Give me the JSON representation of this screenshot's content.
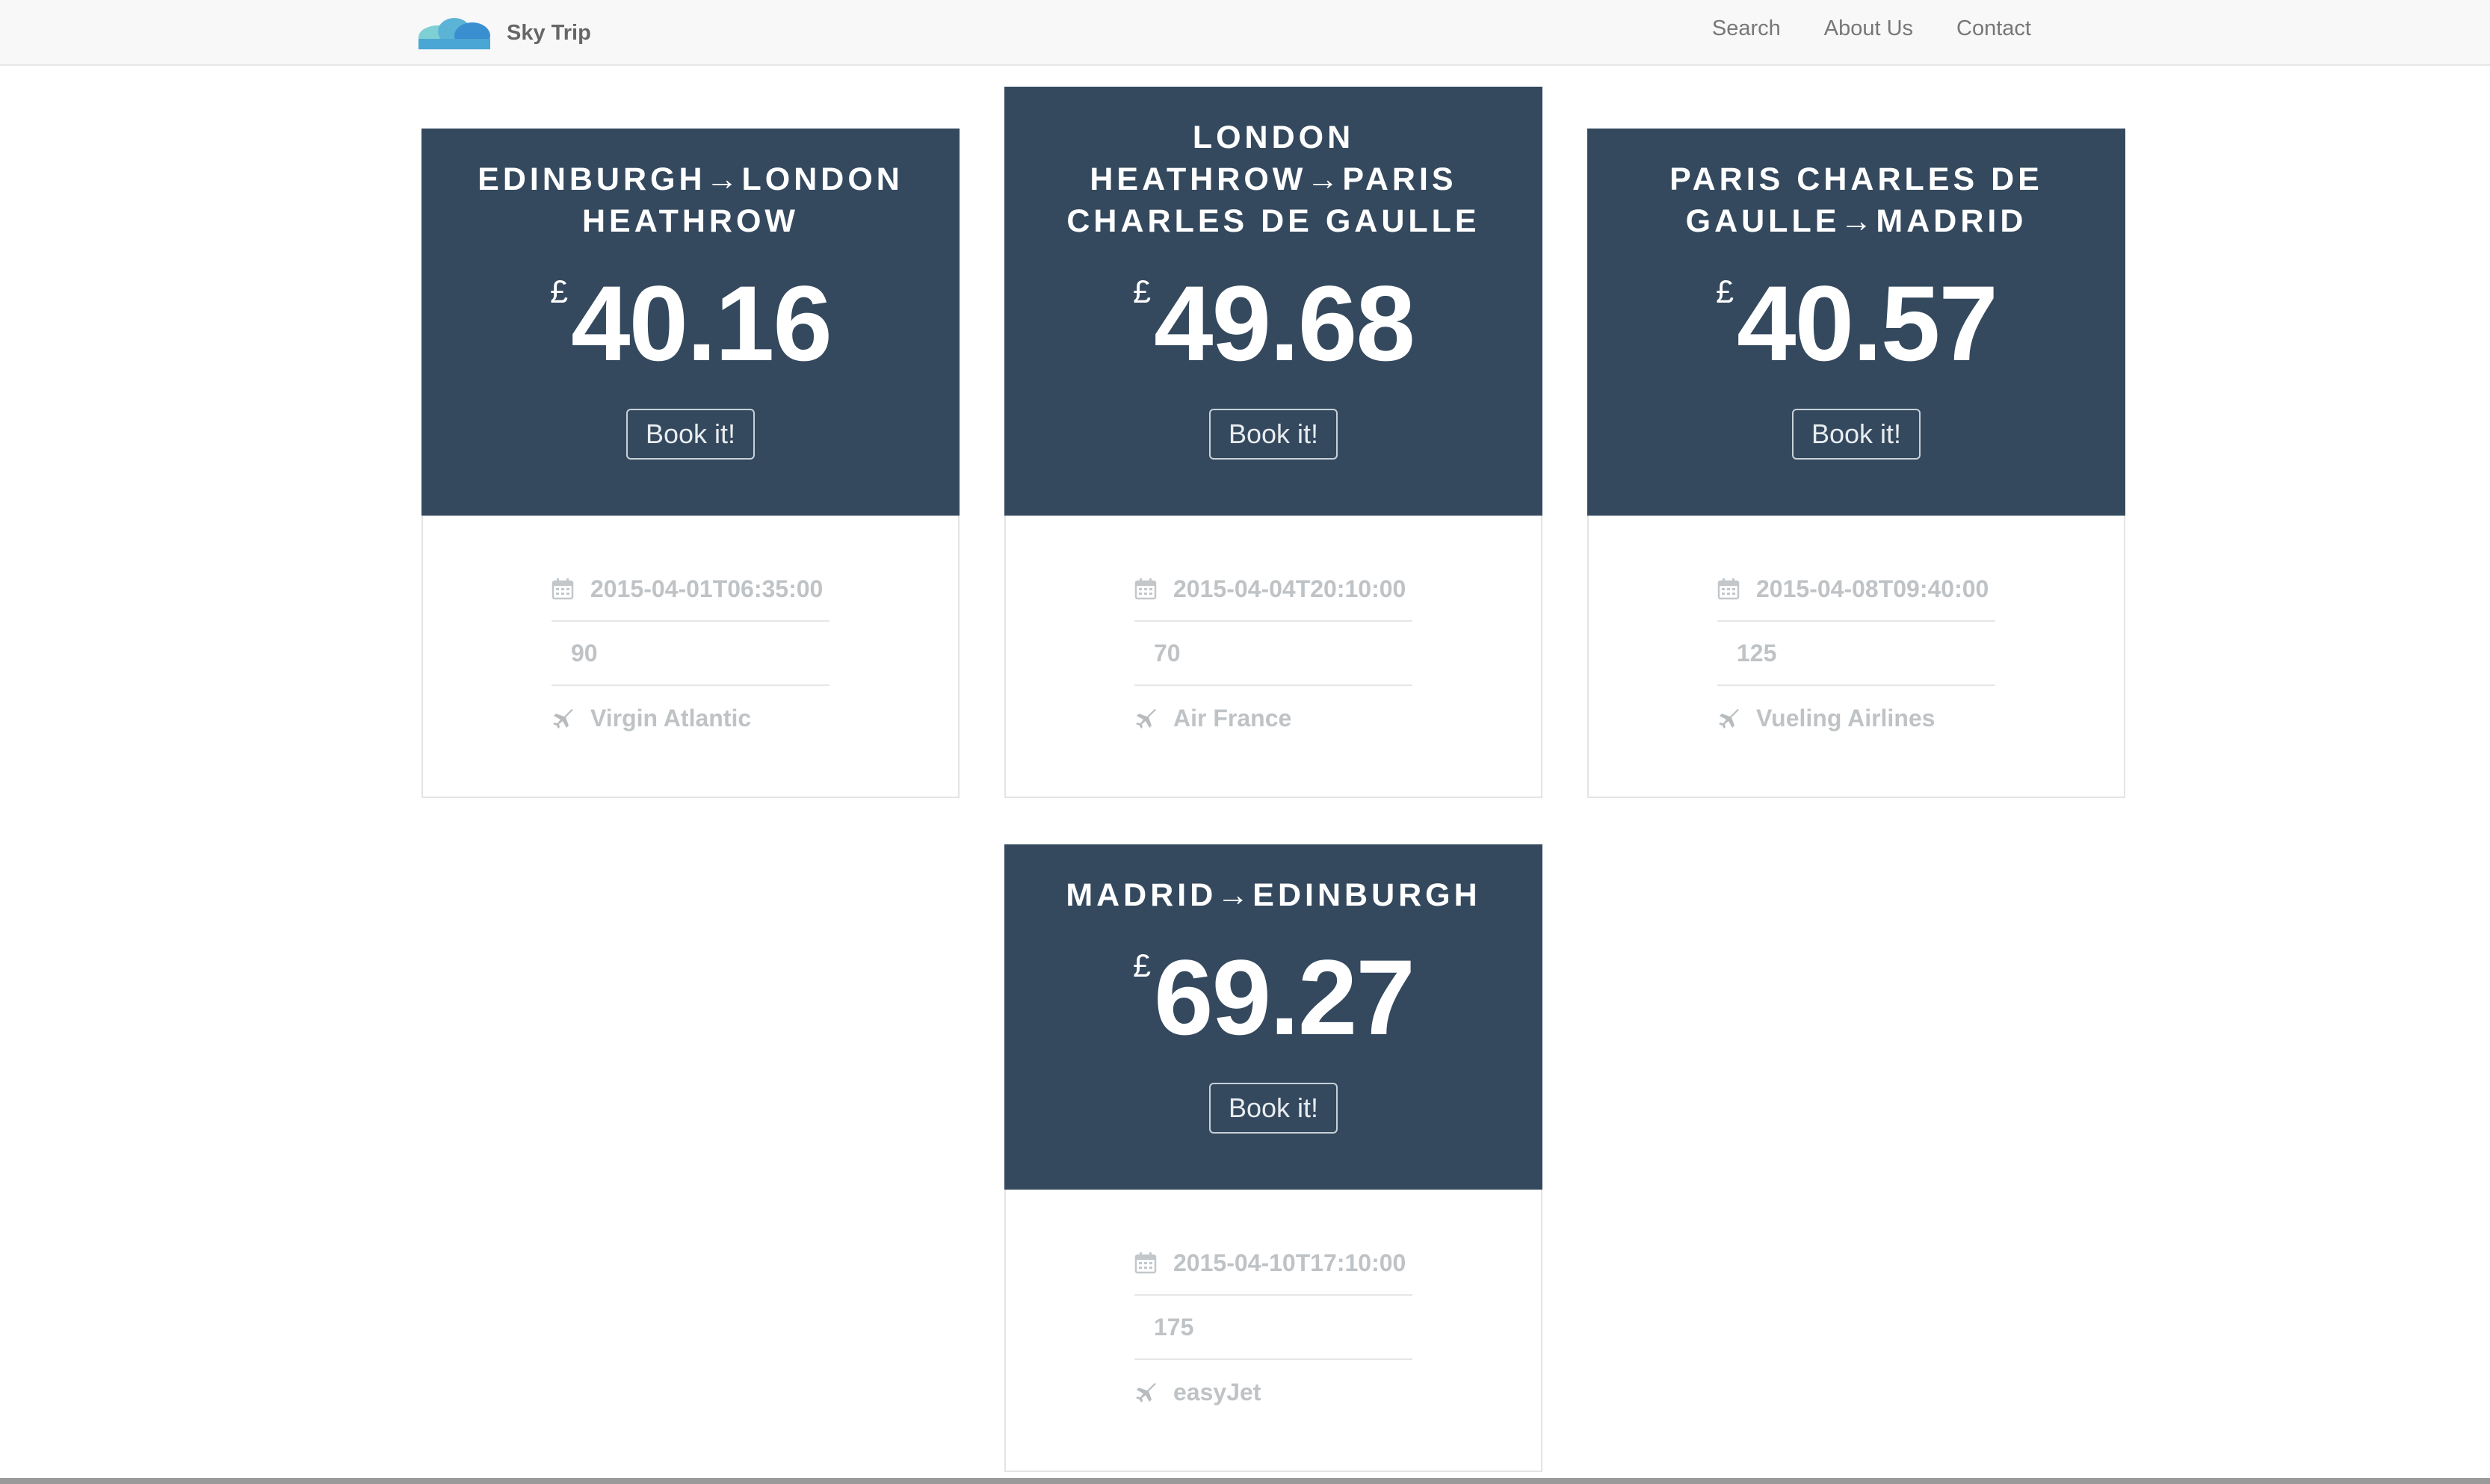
{
  "nav": {
    "brand": "Sky Trip",
    "links": [
      "Search",
      "About Us",
      "Contact"
    ]
  },
  "colors": {
    "card_header": "#34495e",
    "nav_bg": "#f8f8f8",
    "muted_text": "#bfc3c6"
  },
  "flights": [
    {
      "route": "Edinburgh→London Heathrow",
      "currency": "£",
      "price": "40.16",
      "book_label": "Book it!",
      "datetime": "2015-04-01T06:35:00",
      "number": "90",
      "airline": "Virgin Atlantic"
    },
    {
      "route": "London Heathrow→Paris Charles de Gaulle",
      "currency": "£",
      "price": "49.68",
      "book_label": "Book it!",
      "datetime": "2015-04-04T20:10:00",
      "number": "70",
      "airline": "Air France"
    },
    {
      "route": "Paris Charles de Gaulle→Madrid",
      "currency": "£",
      "price": "40.57",
      "book_label": "Book it!",
      "datetime": "2015-04-08T09:40:00",
      "number": "125",
      "airline": "Vueling Airlines"
    },
    {
      "route": "Madrid→Edinburgh",
      "currency": "£",
      "price": "69.27",
      "book_label": "Book it!",
      "datetime": "2015-04-10T17:10:00",
      "number": "175",
      "airline": "easyJet"
    }
  ]
}
